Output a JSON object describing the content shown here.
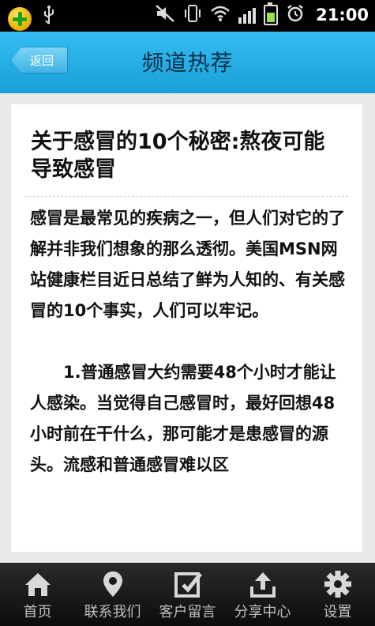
{
  "status_bar": {
    "time": "21:00"
  },
  "header": {
    "back_label": "返回",
    "title": "频道热荐"
  },
  "article": {
    "title": "关于感冒的10个秘密:熬夜可能导致感冒",
    "paragraphs": [
      "感冒是最常见的疾病之一，但人们对它的了解并非我们想象的那么透彻。美国MSN网站健康栏目近日总结了鲜为人知的、有关感冒的10个事实，人们可以牢记。",
      "1.普通感冒大约需要48个小时才能让人感染。当觉得自己感冒时，最好回想48小时前在干什么，那可能才是患感冒的源头。流感和普通感冒难以区"
    ]
  },
  "bottom_nav": {
    "items": [
      {
        "label": "首页",
        "icon": "home-icon"
      },
      {
        "label": "联系我们",
        "icon": "location-pin-icon"
      },
      {
        "label": "客户留言",
        "icon": "edit-icon"
      },
      {
        "label": "分享中心",
        "icon": "share-upload-icon"
      },
      {
        "label": "设置",
        "icon": "gear-icon"
      }
    ]
  }
}
